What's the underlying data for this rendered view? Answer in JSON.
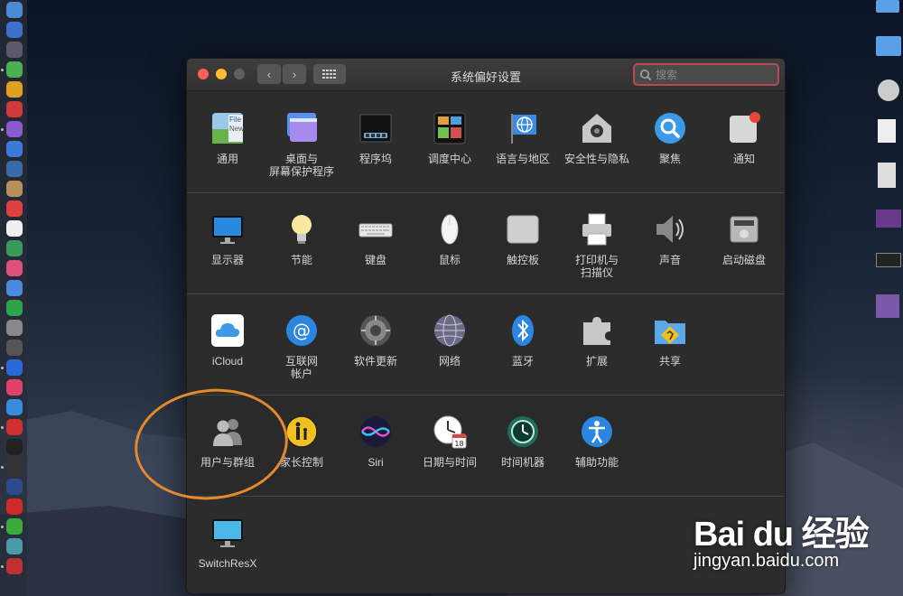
{
  "window": {
    "title": "系统偏好设置",
    "search_placeholder": "搜索",
    "back_label": "‹",
    "forward_label": "›"
  },
  "rows": [
    [
      {
        "id": "general",
        "label": "通用",
        "icon": "general-icon"
      },
      {
        "id": "desktop",
        "label": "桌面与\n屏幕保护程序",
        "icon": "desktop-screensaver-icon"
      },
      {
        "id": "dock",
        "label": "程序坞",
        "icon": "dock-icon"
      },
      {
        "id": "mission",
        "label": "调度中心",
        "icon": "mission-control-icon"
      },
      {
        "id": "language",
        "label": "语言与地区",
        "icon": "language-region-icon"
      },
      {
        "id": "security",
        "label": "安全性与隐私",
        "icon": "security-privacy-icon"
      },
      {
        "id": "spotlight",
        "label": "聚焦",
        "icon": "spotlight-icon"
      },
      {
        "id": "notifications",
        "label": "通知",
        "icon": "notifications-icon"
      }
    ],
    [
      {
        "id": "displays",
        "label": "显示器",
        "icon": "display-icon"
      },
      {
        "id": "energy",
        "label": "节能",
        "icon": "energy-saver-icon"
      },
      {
        "id": "keyboard",
        "label": "键盘",
        "icon": "keyboard-icon"
      },
      {
        "id": "mouse",
        "label": "鼠标",
        "icon": "mouse-icon"
      },
      {
        "id": "trackpad",
        "label": "触控板",
        "icon": "trackpad-icon"
      },
      {
        "id": "printers",
        "label": "打印机与\n扫描仪",
        "icon": "printer-icon"
      },
      {
        "id": "sound",
        "label": "声音",
        "icon": "sound-icon"
      },
      {
        "id": "startup",
        "label": "启动磁盘",
        "icon": "startup-disk-icon"
      }
    ],
    [
      {
        "id": "icloud",
        "label": "iCloud",
        "icon": "icloud-icon"
      },
      {
        "id": "internet",
        "label": "互联网\n帐户",
        "icon": "internet-accounts-icon"
      },
      {
        "id": "update",
        "label": "软件更新",
        "icon": "software-update-icon"
      },
      {
        "id": "network",
        "label": "网络",
        "icon": "network-icon"
      },
      {
        "id": "bluetooth",
        "label": "蓝牙",
        "icon": "bluetooth-icon"
      },
      {
        "id": "extensions",
        "label": "扩展",
        "icon": "extensions-icon"
      },
      {
        "id": "sharing",
        "label": "共享",
        "icon": "sharing-icon"
      }
    ],
    [
      {
        "id": "users",
        "label": "用户与群组",
        "icon": "users-groups-icon"
      },
      {
        "id": "parental",
        "label": "家长控制",
        "icon": "parental-controls-icon"
      },
      {
        "id": "siri",
        "label": "Siri",
        "icon": "siri-icon"
      },
      {
        "id": "datetime",
        "label": "日期与时间",
        "icon": "date-time-icon"
      },
      {
        "id": "timemachine",
        "label": "时间机器",
        "icon": "time-machine-icon"
      },
      {
        "id": "accessibility",
        "label": "辅助功能",
        "icon": "accessibility-icon"
      }
    ],
    [
      {
        "id": "switchresx",
        "label": "SwitchResX",
        "icon": "switchresx-icon"
      }
    ]
  ],
  "calendar_icon_day": "18",
  "watermark": {
    "brand": "Bai du 经验",
    "url": "jingyan.baidu.com"
  },
  "colors": {
    "close": "#ff5f57",
    "minimize": "#febc2e",
    "zoom": "#5f5f5f",
    "search_border": "#b84a56",
    "annotation_circle": "#e38a2c"
  }
}
